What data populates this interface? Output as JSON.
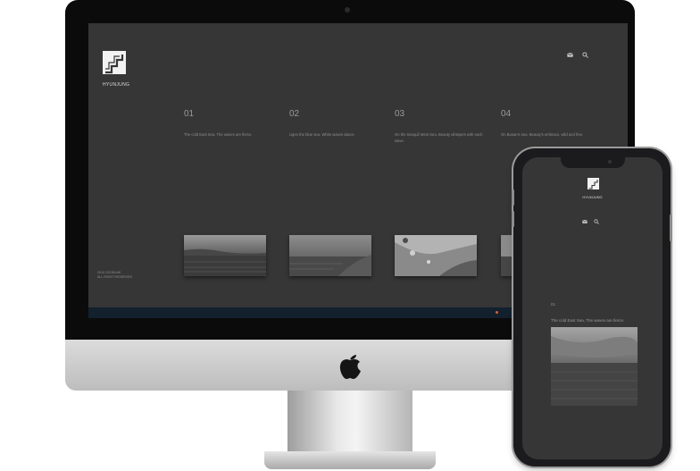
{
  "brand": {
    "name": "HYUNJUNG"
  },
  "desktop": {
    "columns": [
      {
        "number": "01",
        "text": "The cold East Sea, The waves are fierce."
      },
      {
        "number": "02",
        "text": "Ugeo the blue sea, White waves dance."
      },
      {
        "number": "03",
        "text": "On the tranquil West Sea, Beauty whispers with each wave."
      },
      {
        "number": "04",
        "text": "On Busan's sea, Beauty's embrace, wild and free."
      }
    ],
    "copyright": {
      "line1": "2019 GCOBLHK",
      "line2": "ALL RIGHT RESERVED"
    }
  },
  "mobile": {
    "section_number": "01",
    "section_text": "The cold East Sea, The waves are fierce."
  },
  "icons": [
    "mail-icon",
    "search-icon",
    "apple-logo-icon"
  ],
  "colors": {
    "site_background": "#363636",
    "taskbar": "#13202e",
    "bezel": "#0b0b0c"
  }
}
